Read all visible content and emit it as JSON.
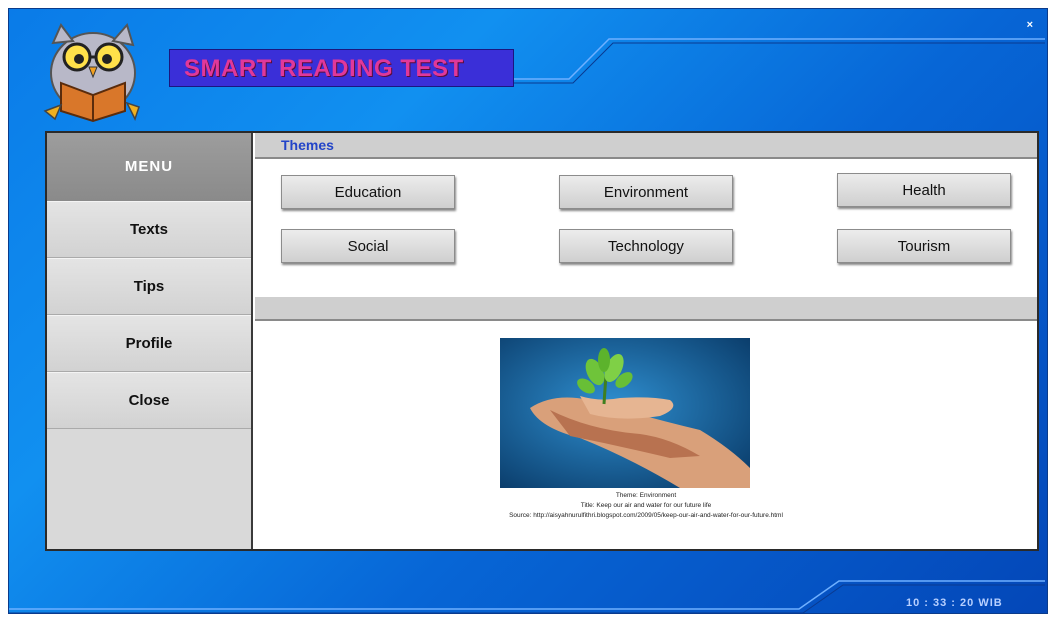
{
  "app": {
    "title": "SMART READING TEST",
    "close_label": "×"
  },
  "sidebar": {
    "header": "MENU",
    "items": [
      {
        "label": "Texts"
      },
      {
        "label": "Tips"
      },
      {
        "label": "Profile"
      },
      {
        "label": "Close"
      }
    ]
  },
  "themes": {
    "heading": "Themes",
    "buttons": [
      {
        "label": "Education"
      },
      {
        "label": "Environment"
      },
      {
        "label": "Health"
      },
      {
        "label": "Social"
      },
      {
        "label": "Technology"
      },
      {
        "label": "Tourism"
      }
    ]
  },
  "image_caption": {
    "theme": "Theme: Environment",
    "title": "Title: Keep our air and water for our future life",
    "source": "Source: http://aisyahnurulfithri.blogspot.com/2009/05/keep-our-air-and-water-for-our-future.html"
  },
  "status": {
    "clock": "10 : 33 : 20  WIB"
  },
  "colors": {
    "background_blue": "#0a7be8",
    "title_box": "#3a2fd8",
    "title_text": "#e0389a",
    "themes_heading": "#2244c8"
  }
}
